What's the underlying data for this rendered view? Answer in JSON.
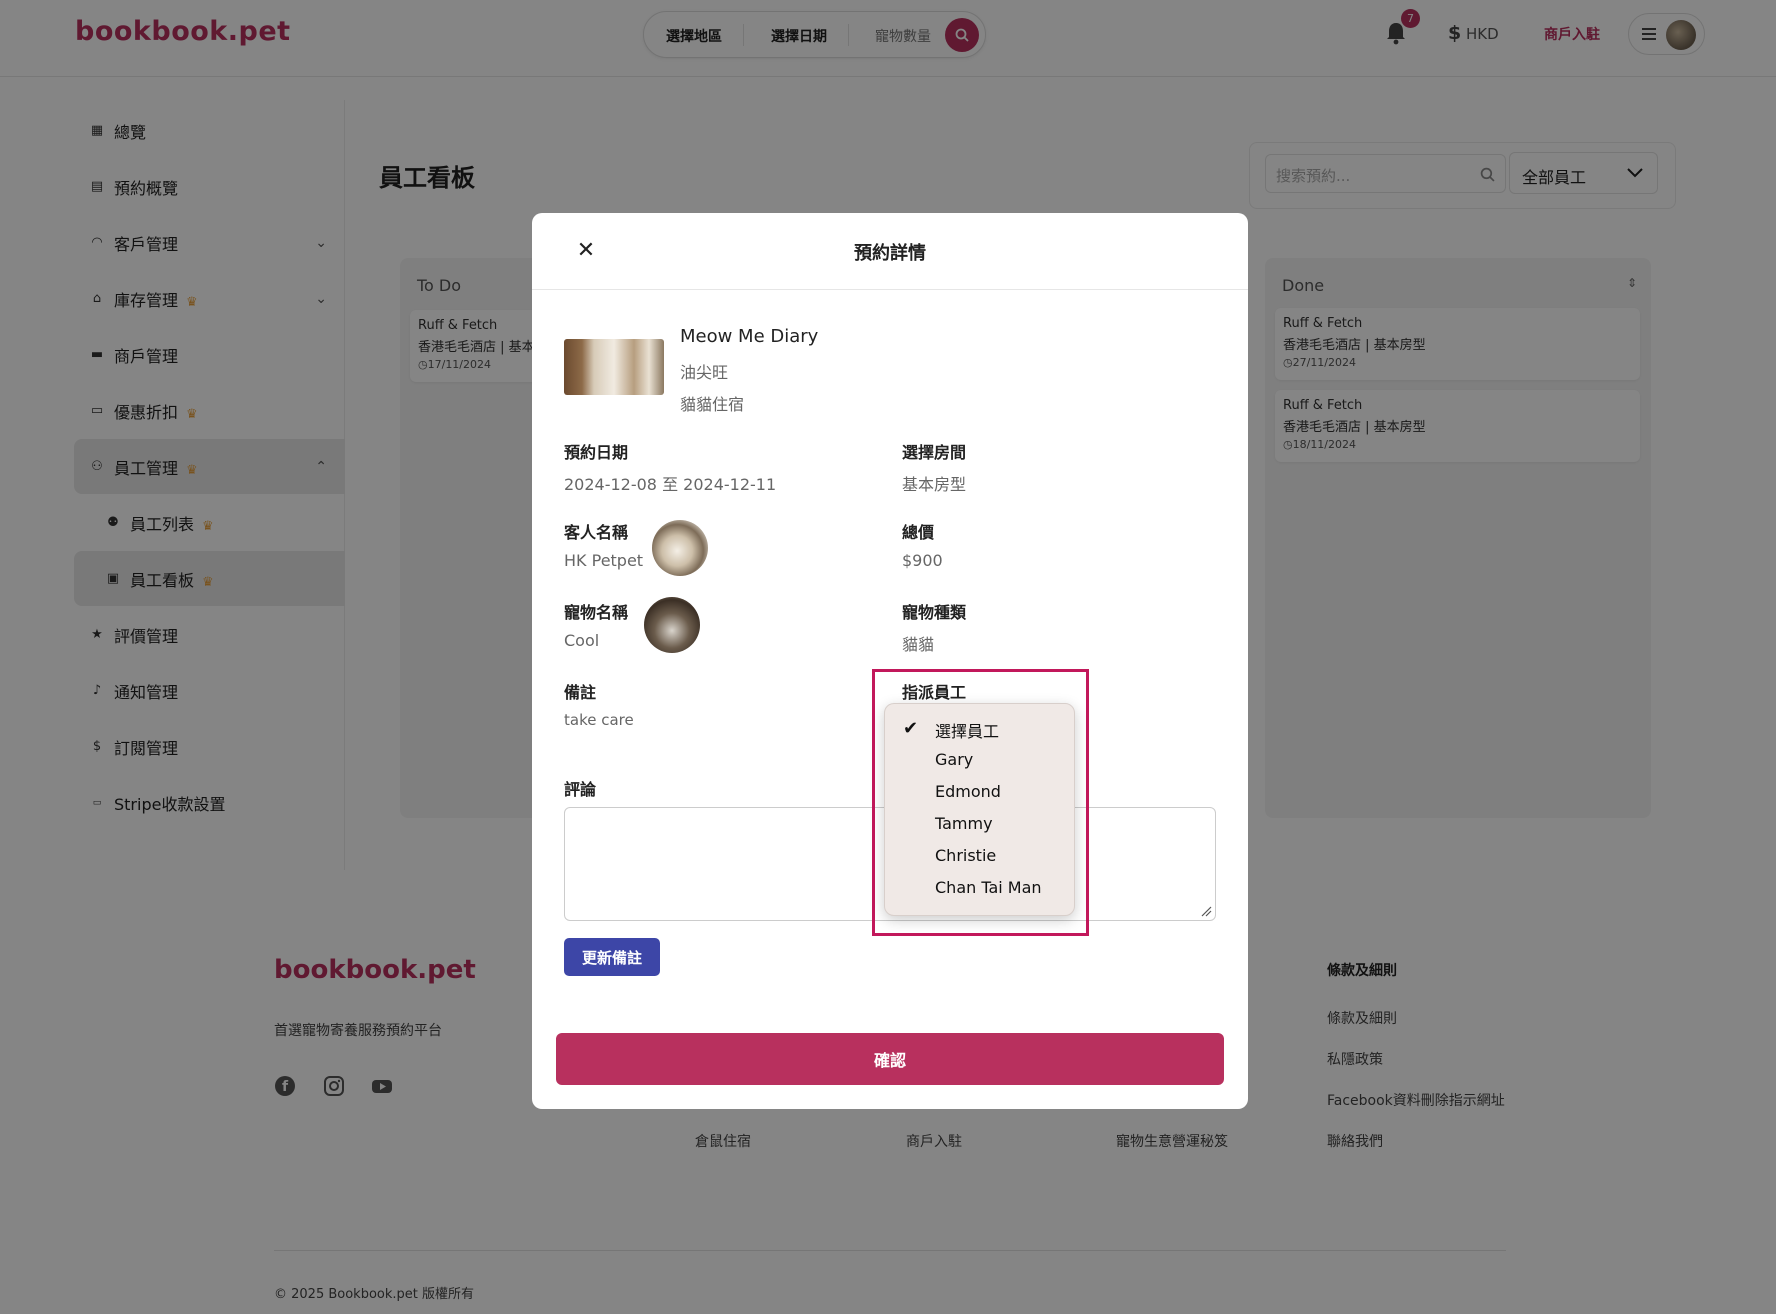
{
  "header": {
    "logo": "bookbook.pet",
    "search": {
      "region": "選擇地區",
      "date": "選擇日期",
      "pets": "寵物數量"
    },
    "notification_count": "7",
    "currency": "HKD",
    "merchant_link": "商戶入駐"
  },
  "sidebar": {
    "items": [
      {
        "label": "總覽",
        "icon": "dashboard-icon"
      },
      {
        "label": "預約概覽",
        "icon": "calendar-icon"
      },
      {
        "label": "客戶管理",
        "icon": "headset-icon"
      },
      {
        "label": "庫存管理",
        "icon": "warehouse-icon"
      },
      {
        "label": "商戶管理",
        "icon": "store-icon"
      },
      {
        "label": "優惠折扣",
        "icon": "ticket-icon"
      },
      {
        "label": "員工管理",
        "icon": "org-chart-icon"
      },
      {
        "label": "員工列表",
        "icon": "people-icon"
      },
      {
        "label": "員工看板",
        "icon": "board-icon"
      },
      {
        "label": "評價管理",
        "icon": "star-icon"
      },
      {
        "label": "通知管理",
        "icon": "bell-icon"
      },
      {
        "label": "訂閱管理",
        "icon": "dollar-icon"
      },
      {
        "label": "Stripe收款設置",
        "icon": "stripe-icon"
      }
    ]
  },
  "main": {
    "title": "員工看板",
    "search_placeholder": "搜索預約...",
    "staff_filter": "全部員工",
    "columns": [
      {
        "title": "To Do",
        "cards": [
          {
            "merchant": "Ruff & Fetch",
            "detail": "香港毛毛酒店 | 基本",
            "date": "17/11/2024"
          }
        ]
      },
      {
        "title": "Done",
        "cards": [
          {
            "merchant": "Ruff & Fetch",
            "detail": "香港毛毛酒店 | 基本房型",
            "date": "27/11/2024"
          },
          {
            "merchant": "Ruff & Fetch",
            "detail": "香港毛毛酒店 | 基本房型",
            "date": "18/11/2024"
          }
        ]
      }
    ]
  },
  "modal": {
    "title": "預約詳情",
    "shop": {
      "name": "Meow Me Diary",
      "area": "油尖旺",
      "type": "貓貓住宿"
    },
    "booking_date_label": "預約日期",
    "booking_date": "2024-12-08 至 2024-12-11",
    "room_label": "選擇房間",
    "room": "基本房型",
    "customer_label": "客人名稱",
    "customer": "HK Petpet",
    "total_label": "總價",
    "total": "$900",
    "pet_name_label": "寵物名稱",
    "pet_name": "Cool",
    "pet_type_label": "寵物種類",
    "pet_type": "貓貓",
    "note_label": "備註",
    "note": "take care",
    "assign_label": "指派員工",
    "comment_label": "評論",
    "update_button": "更新備註",
    "confirm_button": "確認",
    "staff_options": [
      "選擇員工",
      "Gary",
      "Edmond",
      "Tammy",
      "Christie",
      "Chan Tai Man"
    ],
    "selected_option": "選擇員工"
  },
  "footer": {
    "logo": "bookbook.pet",
    "tagline": "首選寵物寄養服務預約平台",
    "terms_heading": "條款及細則",
    "terms_links": [
      "條款及細則",
      "私隱政策",
      "Facebook資料刪除指示網址",
      "聯絡我們"
    ],
    "bottom_links": [
      "倉鼠住宿",
      "商戶入駐",
      "寵物生意營運秘笈"
    ],
    "copyright": "© 2025 Bookbook.pet 版權所有"
  }
}
